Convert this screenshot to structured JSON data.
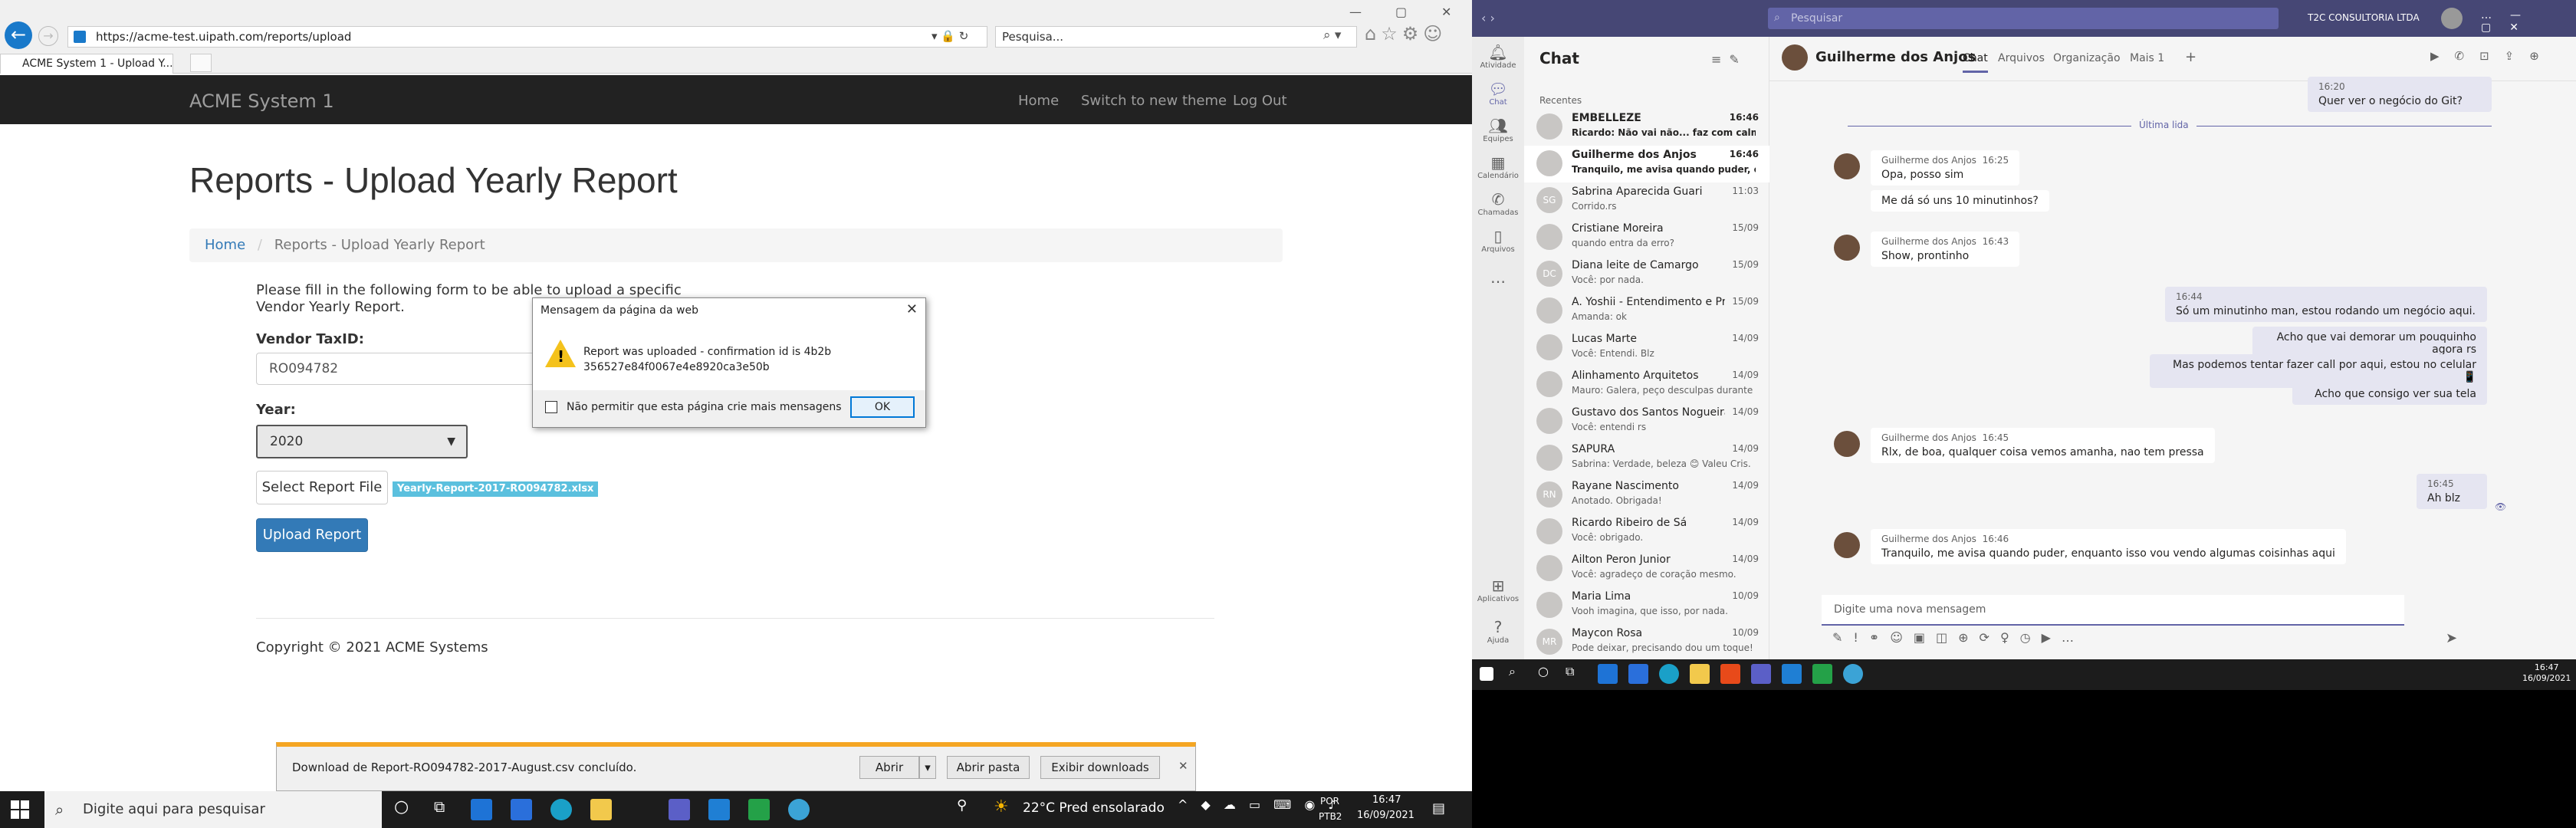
{
  "browser": {
    "url": "https://acme-test.uipath.com/reports/upload",
    "search_placeholder": "Pesquisa...",
    "tab_title": "ACME System 1 - Upload Y..."
  },
  "page": {
    "brand": "ACME System 1",
    "nav": [
      "Home",
      "Switch to new theme",
      "Log Out"
    ],
    "title": "Reports - Upload Yearly Report",
    "breadcrumb_home": "Home",
    "breadcrumb_current": "Reports - Upload Yearly Report",
    "intro": "Please fill in the following form to be able to upload a specific Vendor Yearly Report.",
    "vendor_label": "Vendor TaxID:",
    "vendor_value": "RO094782",
    "year_label": "Year:",
    "year_value": "2020",
    "select_file_label": "Select Report File",
    "file_chip": "Yearly-Report-2017-RO094782.xlsx",
    "upload_label": "Upload Report",
    "copyright": "Copyright © 2021 ACME Systems"
  },
  "dialog": {
    "title": "Mensagem da página da web",
    "message": "Report was uploaded - confirmation id is 4b2b356527e84f0067e4e8920ca3e50b",
    "checkbox_label": "Não permitir que esta página crie mais mensagens",
    "ok_label": "OK"
  },
  "download_bar": {
    "text": "Download de Report-RO094782-2017-August.csv concluído.",
    "open_label": "Abrir",
    "open_folder_label": "Abrir pasta",
    "show_downloads_label": "Exibir downloads"
  },
  "taskbar": {
    "search_placeholder": "Digite aqui para pesquisar",
    "weather": "22°C  Pred ensolarado",
    "lang1": "POR",
    "lang2": "PTB2",
    "time": "16:47",
    "date": "16/09/2021"
  },
  "teams": {
    "search_placeholder": "Pesquisar",
    "org": "T2C CONSULTORIA LTDA",
    "rail": [
      "Atividade",
      "Chat",
      "Equipes",
      "Calendário",
      "Chamadas",
      "Arquivos",
      "Aplicativos",
      "Ajuda"
    ],
    "chat_header": "Chat",
    "recent_label": "Recentes",
    "chats": [
      {
        "name": "EMBELLEZE",
        "preview": "Ricardo: Não vai não... faz com calma ...",
        "time": "16:46",
        "initials": "",
        "bold": true
      },
      {
        "name": "Guilherme dos Anjos",
        "preview": "Tranquilo, me avisa quando puder, en...",
        "time": "16:46",
        "initials": "",
        "bold": true
      },
      {
        "name": "Sabrina Aparecida Guari",
        "preview": "Corrido.rs",
        "time": "11:03",
        "initials": "SG"
      },
      {
        "name": "Cristiane Moreira",
        "preview": "quando entra da erro?",
        "time": "15/09",
        "initials": ""
      },
      {
        "name": "Diana leite de Camargo",
        "preview": "Você: por nada.",
        "time": "15/09",
        "initials": "DC"
      },
      {
        "name": "A. Yoshii - Entendimento e Prep...",
        "preview": "Amanda: ok",
        "time": "15/09",
        "initials": ""
      },
      {
        "name": "Lucas Marte",
        "preview": "Você: Entendi. Blz",
        "time": "14/09",
        "initials": ""
      },
      {
        "name": "Alinhamento Arquitetos",
        "preview": "Mauro: Galera, peço desculpas durante a...",
        "time": "14/09",
        "initials": ""
      },
      {
        "name": "Gustavo dos Santos Nogueira",
        "preview": "Você: entendi rs",
        "time": "14/09",
        "initials": ""
      },
      {
        "name": "SAPURA",
        "preview": "Sabrina: Verdade, beleza 😊 Valeu Cris.",
        "time": "14/09",
        "initials": ""
      },
      {
        "name": "Rayane Nascimento",
        "preview": "Anotado. Obrigada!",
        "time": "14/09",
        "initials": "RN"
      },
      {
        "name": "Ricardo Ribeiro de Sá",
        "preview": "Você: obrigado.",
        "time": "14/09",
        "initials": ""
      },
      {
        "name": "Ailton Peron Junior",
        "preview": "Você: agradeço de coração mesmo.",
        "time": "14/09",
        "initials": ""
      },
      {
        "name": "Maria Lima",
        "preview": "Vooh imagina, que isso, por nada.",
        "time": "10/09",
        "initials": ""
      },
      {
        "name": "Maycon Rosa",
        "preview": "Pode deixar, precisando dou um toque! ...",
        "time": "10/09",
        "initials": "MR"
      }
    ],
    "conversation": {
      "name": "Guilherme dos Anjos",
      "tabs": [
        "Chat",
        "Arquivos",
        "Organização",
        "Mais 1"
      ],
      "last_read": "Última lida",
      "messages": [
        {
          "dir": "out",
          "time": "16:20",
          "text": "Quer ver o negócio do Git?"
        },
        {
          "dir": "in",
          "author": "Guilherme dos Anjos",
          "time": "16:25",
          "lines": [
            "Opa, posso sim",
            "Me dá só uns 10 minutinhos?"
          ]
        },
        {
          "dir": "in",
          "author": "Guilherme dos Anjos",
          "time": "16:43",
          "lines": [
            "Show, prontinho"
          ]
        },
        {
          "dir": "out",
          "time": "16:44",
          "lines": [
            "Só um minutinho man, estou rodando um negócio aqui.",
            "Acho que vai demorar um pouquinho agora rs",
            "Mas podemos tentar fazer call por aqui, estou no celular 📱",
            "Acho que consigo ver sua tela"
          ]
        },
        {
          "dir": "in",
          "author": "Guilherme dos Anjos",
          "time": "16:45",
          "lines": [
            "Rlx, de boa, qualquer coisa vemos amanha, nao tem pressa"
          ]
        },
        {
          "dir": "out",
          "time": "16:45",
          "lines": [
            "Ah blz"
          ]
        },
        {
          "dir": "in",
          "author": "Guilherme dos Anjos",
          "time": "16:46",
          "lines": [
            "Tranquilo, me avisa quando puder, enquanto isso vou vendo algumas coisinhas aqui"
          ]
        }
      ],
      "compose_placeholder": "Digite uma nova mensagem"
    },
    "time": "16:47",
    "date": "16/09/2021"
  }
}
